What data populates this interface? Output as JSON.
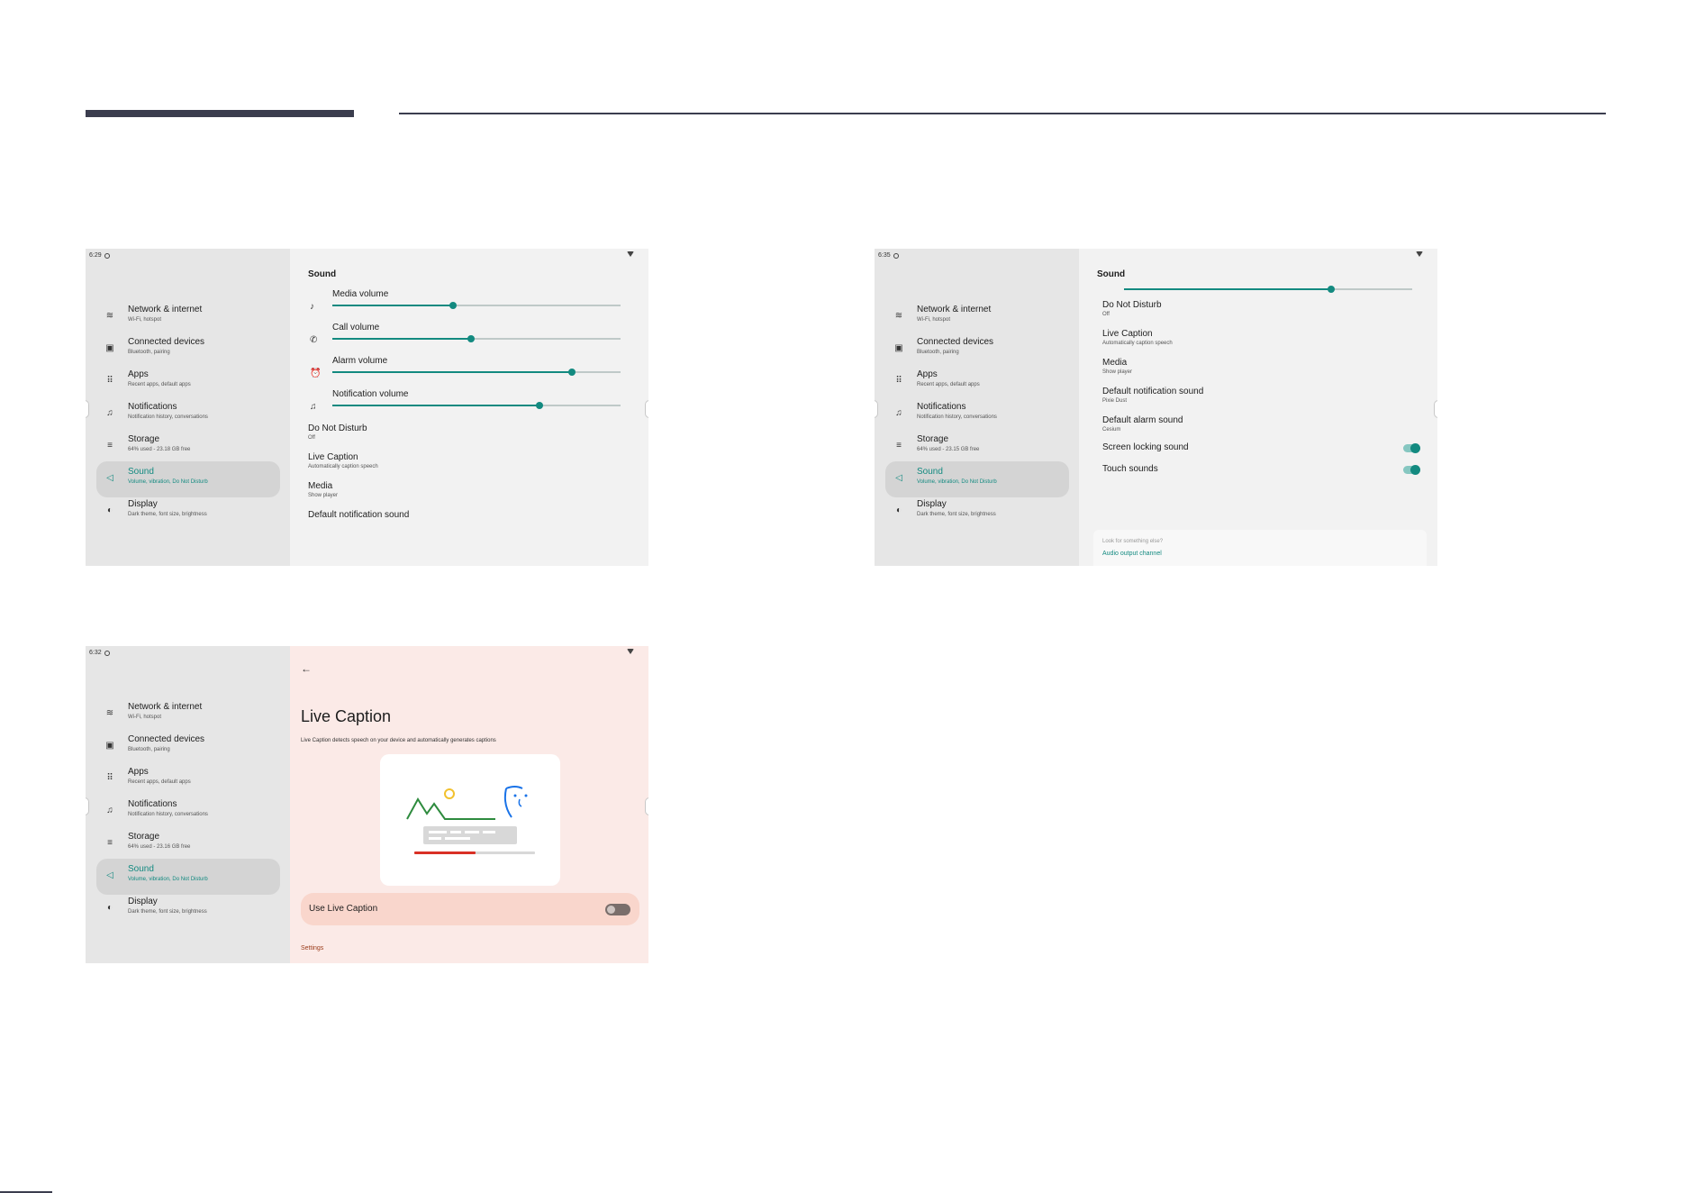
{
  "nav_items": [
    {
      "title": "Network & internet",
      "sub": "Wi-Fi, hotspot",
      "icon": "wifi-icon",
      "glyph": "≋"
    },
    {
      "title": "Connected devices",
      "sub": "Bluetooth, pairing",
      "icon": "devices-icon",
      "glyph": "▣"
    },
    {
      "title": "Apps",
      "sub": "Recent apps, default apps",
      "icon": "apps-grid-icon",
      "glyph": "⠿"
    },
    {
      "title": "Notifications",
      "sub": "Notification history, conversations",
      "icon": "bell-icon",
      "glyph": "♫"
    },
    {
      "title": "Storage",
      "sub": "64% used - 23.18 GB free",
      "icon": "storage-icon",
      "glyph": "≡"
    },
    {
      "title": "Sound",
      "sub": "Volume, vibration, Do Not Disturb",
      "icon": "speaker-icon",
      "glyph": "◁"
    },
    {
      "title": "Display",
      "sub": "Dark theme, font size, brightness",
      "icon": "brightness-icon",
      "glyph": "◐"
    }
  ],
  "screen1": {
    "time": "6:29",
    "title": "Sound",
    "volumes": [
      {
        "label": "Media volume",
        "level": 0.42,
        "icon": "music-note-icon",
        "glyph": "♪"
      },
      {
        "label": "Call volume",
        "level": 0.48,
        "icon": "phone-icon",
        "glyph": "✆"
      },
      {
        "label": "Alarm volume",
        "level": 0.83,
        "icon": "alarm-icon",
        "glyph": "⏰"
      },
      {
        "label": "Notification volume",
        "level": 0.72,
        "icon": "bell-icon",
        "glyph": "♫"
      }
    ],
    "items": [
      {
        "title": "Do Not Disturb",
        "sub": "Off"
      },
      {
        "title": "Live Caption",
        "sub": "Automatically caption speech"
      },
      {
        "title": "Media",
        "sub": "Show player"
      },
      {
        "title": "Default notification sound",
        "sub": ""
      }
    ]
  },
  "screen2": {
    "time": "6:35",
    "title": "Sound",
    "storage_sub": "64% used - 23.15 GB free",
    "slider_level": 0.72,
    "items": [
      {
        "title": "Do Not Disturb",
        "sub": "Off"
      },
      {
        "title": "Live Caption",
        "sub": "Automatically caption speech"
      },
      {
        "title": "Media",
        "sub": "Show player"
      },
      {
        "title": "Default notification sound",
        "sub": "Pixie Dust"
      },
      {
        "title": "Default alarm sound",
        "sub": "Cesium"
      }
    ],
    "toggles": [
      {
        "label": "Screen locking sound",
        "on": true
      },
      {
        "label": "Touch sounds",
        "on": true
      }
    ],
    "more_question": "Look for something else?",
    "more_link": "Audio output channel"
  },
  "screen3": {
    "time": "6:32",
    "storage_sub": "64% used - 23.16 GB free",
    "title": "Live Caption",
    "description": "Live Caption detects speech on your device and automatically generates captions",
    "use_label": "Use Live Caption",
    "use_on": false,
    "settings_label": "Settings"
  },
  "colors": {
    "accent": "#138a80",
    "header": "#3b3d4e",
    "pink_bg": "#fbeae7"
  }
}
